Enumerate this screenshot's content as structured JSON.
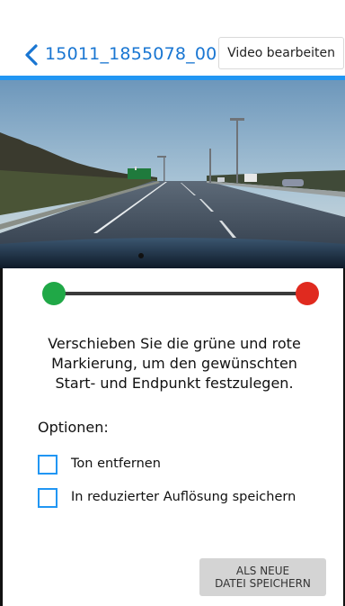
{
  "header": {
    "title": "15011_1855078_00",
    "edit_button_label": "Video bearbeiten"
  },
  "video": {
    "sign_text": "Leeds"
  },
  "trim": {
    "start_fraction": 0.0,
    "end_fraction": 1.0
  },
  "instructions": {
    "line1": "Verschieben Sie die grüne und rote",
    "line2": "Markierung, um den gewünschten",
    "line3": "Start- und Endpunkt festzulegen."
  },
  "options": {
    "label": "Optionen:",
    "items": [
      {
        "label": "Ton entfernen",
        "checked": false
      },
      {
        "label": "In reduzierter Auflösung speichern",
        "checked": false
      }
    ]
  },
  "save_button": {
    "line1": "ALS NEUE",
    "line2": "DATEI SPEICHERN"
  },
  "colors": {
    "accent": "#2196f3",
    "title": "#1976d2",
    "start_marker": "#20a847",
    "end_marker": "#e02a1f"
  },
  "icons": {
    "back": "chevron-left-icon"
  }
}
